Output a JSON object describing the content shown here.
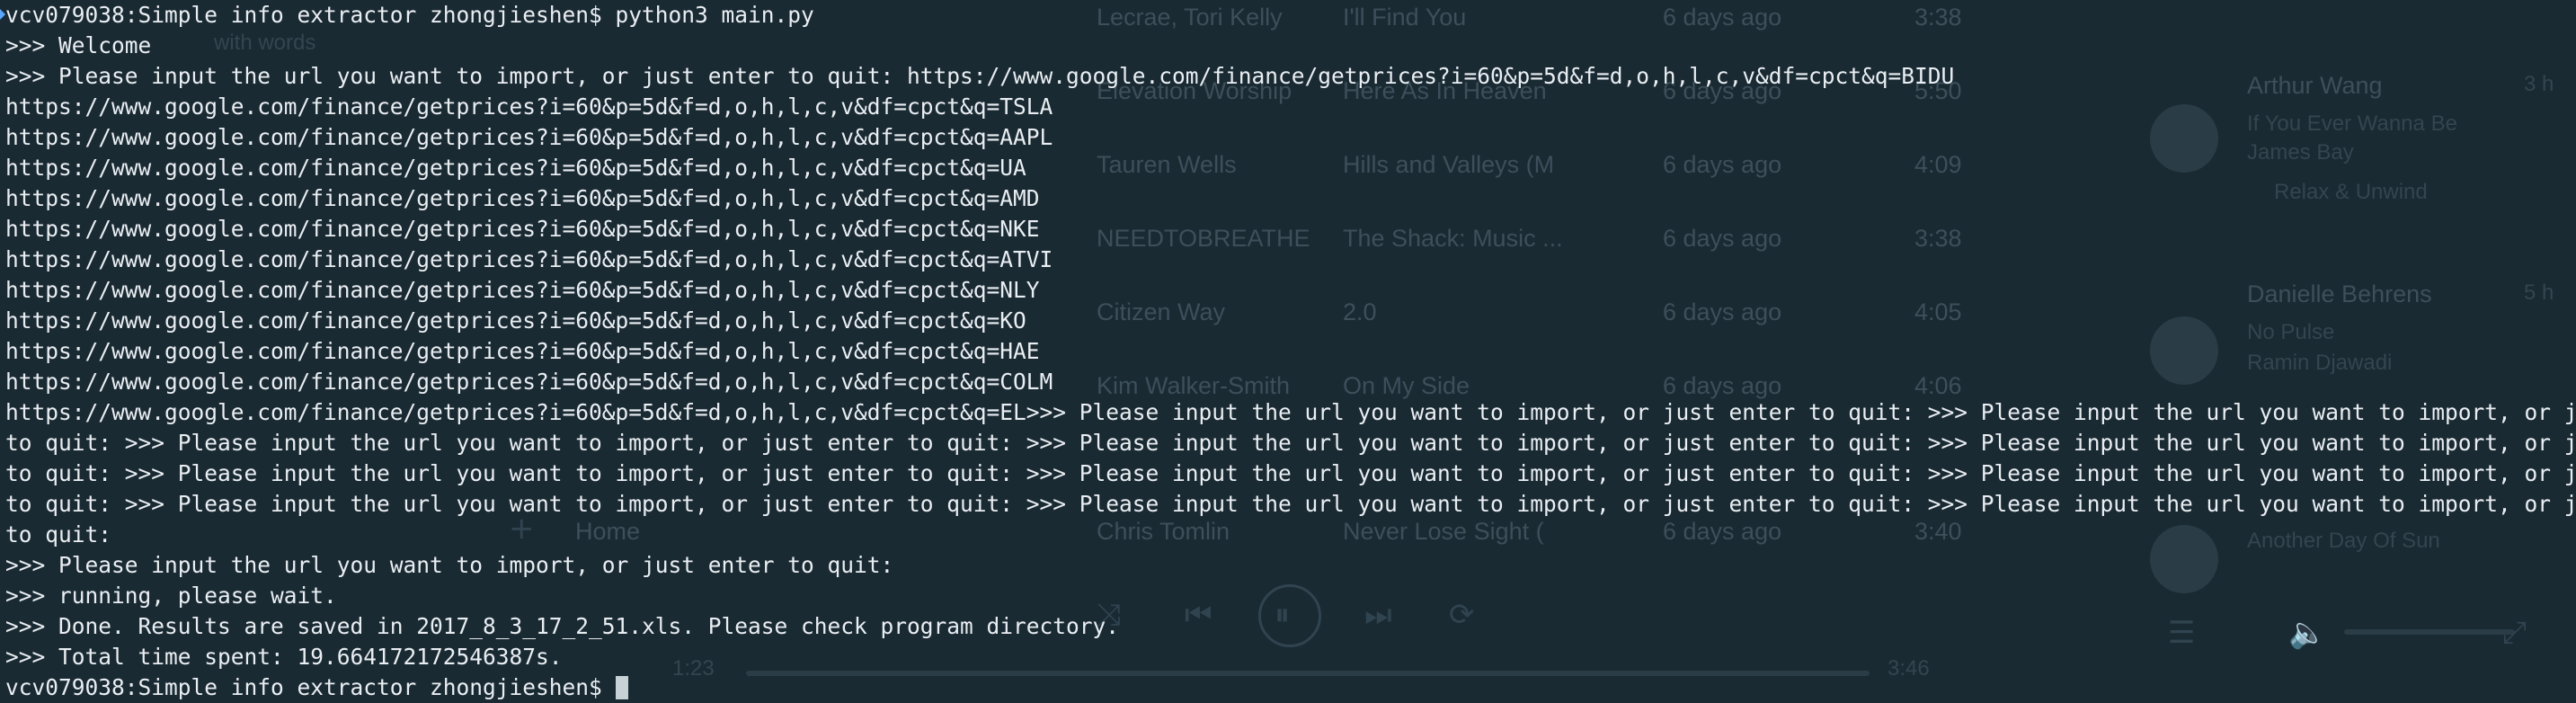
{
  "background_app": {
    "rows": [
      {
        "artist": "Lecrae, Tori Kelly",
        "title": "I'll Find You",
        "added": "6 days ago",
        "duration": "3:38"
      },
      {
        "artist": "Elevation Worship",
        "title": "Here As In Heaven",
        "added": "6 days ago",
        "duration": "5:50"
      },
      {
        "artist": "Tauren Wells",
        "title": "Hills and Valleys (M",
        "added": "6 days ago",
        "duration": "4:09"
      },
      {
        "artist": "NEEDTOBREATHE",
        "title": "The Shack: Music ...",
        "added": "6 days ago",
        "duration": "3:38"
      },
      {
        "artist": "Citizen Way",
        "title": "2.0",
        "added": "6 days ago",
        "duration": "4:05"
      },
      {
        "artist": "Kim Walker-Smith",
        "title": "On My Side",
        "added": "6 days ago",
        "duration": "4:06"
      },
      {
        "artist": "Chris Tomlin",
        "title": "Never Lose Sight (",
        "added": "6 days ago",
        "duration": "3:40"
      }
    ],
    "sidebar_home": "Home",
    "search_hint": "with words",
    "friends": [
      {
        "name": "Arthur Wang",
        "time": "3 h",
        "track": "If You Ever Wanna Be",
        "artist": "James Bay",
        "playlist": "Relax & Unwind"
      },
      {
        "name": "Danielle Behrens",
        "time": "5 h",
        "track": "No Pulse",
        "artist": "Ramin Djawadi"
      },
      {
        "track": "Another Day Of Sun"
      }
    ],
    "elapsed": "1:23",
    "total": "3:46"
  },
  "terminal": {
    "lines": [
      "vcv079038:Simple info extractor zhongjieshen$ python3 main.py",
      ">>> Welcome",
      ">>> Please input the url you want to import, or just enter to quit: https://www.google.com/finance/getprices?i=60&p=5d&f=d,o,h,l,c,v&df=cpct&q=BIDU",
      "https://www.google.com/finance/getprices?i=60&p=5d&f=d,o,h,l,c,v&df=cpct&q=TSLA",
      "https://www.google.com/finance/getprices?i=60&p=5d&f=d,o,h,l,c,v&df=cpct&q=AAPL",
      "https://www.google.com/finance/getprices?i=60&p=5d&f=d,o,h,l,c,v&df=cpct&q=UA",
      "https://www.google.com/finance/getprices?i=60&p=5d&f=d,o,h,l,c,v&df=cpct&q=AMD",
      "https://www.google.com/finance/getprices?i=60&p=5d&f=d,o,h,l,c,v&df=cpct&q=NKE",
      "https://www.google.com/finance/getprices?i=60&p=5d&f=d,o,h,l,c,v&df=cpct&q=ATVI",
      "https://www.google.com/finance/getprices?i=60&p=5d&f=d,o,h,l,c,v&df=cpct&q=NLY",
      "https://www.google.com/finance/getprices?i=60&p=5d&f=d,o,h,l,c,v&df=cpct&q=KO",
      "https://www.google.com/finance/getprices?i=60&p=5d&f=d,o,h,l,c,v&df=cpct&q=HAE",
      "https://www.google.com/finance/getprices?i=60&p=5d&f=d,o,h,l,c,v&df=cpct&q=COLM",
      "https://www.google.com/finance/getprices?i=60&p=5d&f=d,o,h,l,c,v&df=cpct&q=EL>>> Please input the url you want to import, or just enter to quit: >>> Please input the url you want to import, or just enter",
      "to quit: >>> Please input the url you want to import, or just enter to quit: >>> Please input the url you want to import, or just enter to quit: >>> Please input the url you want to import, or just enter",
      "to quit: >>> Please input the url you want to import, or just enter to quit: >>> Please input the url you want to import, or just enter to quit: >>> Please input the url you want to import, or just enter",
      "to quit: >>> Please input the url you want to import, or just enter to quit: >>> Please input the url you want to import, or just enter to quit: >>> Please input the url you want to import, or just enter",
      "to quit:",
      ">>> Please input the url you want to import, or just enter to quit:",
      ">>> running, please wait.",
      ">>> Done. Results are saved in 2017_8_3_17_2_51.xls. Please check program directory.",
      ">>> Total time spent: 19.664172172546387s."
    ],
    "last_prompt": "vcv079038:Simple info extractor zhongjieshen$ "
  }
}
